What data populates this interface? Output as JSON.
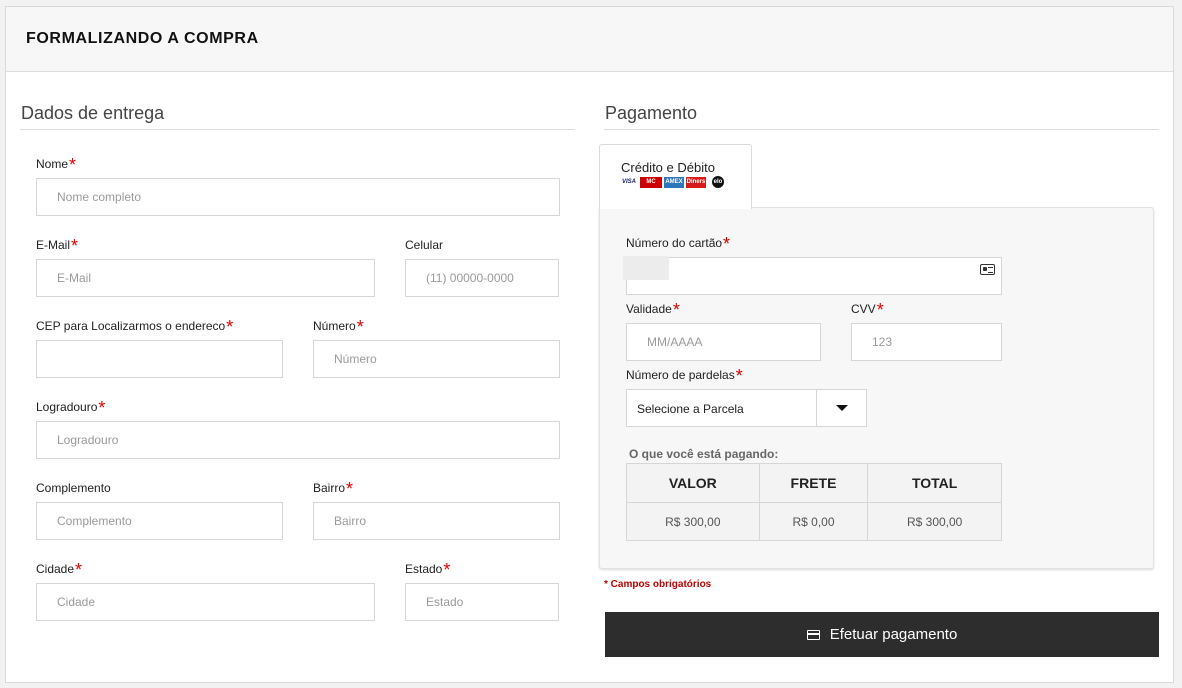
{
  "header": {
    "title": "FORMALIZANDO A COMPRA"
  },
  "delivery": {
    "section_title": "Dados de entrega",
    "required_mark": "*",
    "fields": {
      "nome": {
        "label": "Nome",
        "placeholder": "Nome completo",
        "value": ""
      },
      "email": {
        "label": "E-Mail",
        "placeholder": "E-Mail",
        "value": ""
      },
      "celular": {
        "label": "Celular",
        "placeholder": "(11) 00000-0000",
        "value": ""
      },
      "cep": {
        "label": "CEP para Localizarmos o endereco",
        "placeholder": "",
        "value": ""
      },
      "numero": {
        "label": "Número",
        "placeholder": "Número",
        "value": ""
      },
      "logradouro": {
        "label": "Logradouro",
        "placeholder": "Logradouro",
        "value": ""
      },
      "complemento": {
        "label": "Complemento",
        "placeholder": "Complemento",
        "value": ""
      },
      "bairro": {
        "label": "Bairro",
        "placeholder": "Bairro",
        "value": ""
      },
      "cidade": {
        "label": "Cidade",
        "placeholder": "Cidade",
        "value": ""
      },
      "estado": {
        "label": "Estado",
        "placeholder": "Estado",
        "value": ""
      }
    }
  },
  "payment": {
    "section_title": "Pagamento",
    "tab": {
      "label": "Crédito e Débito",
      "logos": [
        "VISA",
        "MC",
        "AMEX",
        "Diners",
        "elo"
      ]
    },
    "fields": {
      "card_number": {
        "label": "Número do cartão",
        "placeholder": "",
        "value": "",
        "icon": "id-card-icon"
      },
      "validade": {
        "label": "Validade",
        "placeholder": "MM/AAAA",
        "value": ""
      },
      "cvv": {
        "label": "CVV",
        "placeholder": "123",
        "value": ""
      },
      "parcelas": {
        "label": "Número de pardelas",
        "selected": "Selecione a Parcela"
      }
    },
    "summary": {
      "label": "O que você está pagando:",
      "headers": [
        "VALOR",
        "FRETE",
        "TOTAL"
      ],
      "values": [
        "R$ 300,00",
        "R$ 0,00",
        "R$ 300,00"
      ]
    },
    "required_note": "* Campos obrigatórios",
    "submit_label": "Efetuar pagamento",
    "submit_icon": "credit-card-icon"
  },
  "colors": {
    "required": "#e00000",
    "button_bg": "#2d2d2d",
    "header_bg": "#f7f7f7"
  }
}
